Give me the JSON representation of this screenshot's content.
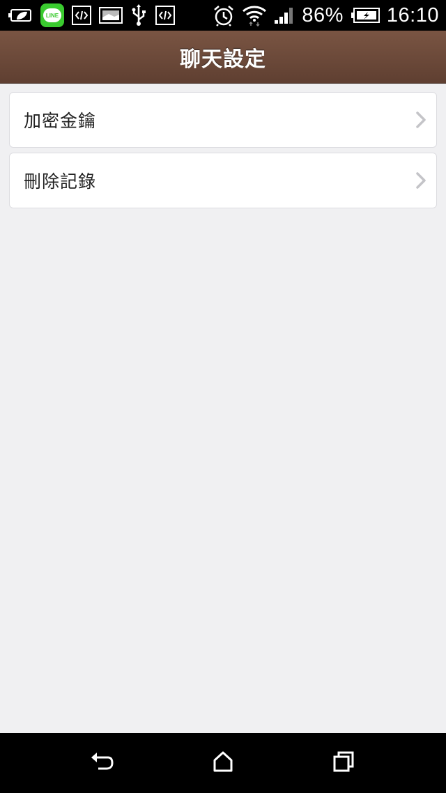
{
  "status_bar": {
    "icons_left": [
      "battery-saver-icon",
      "line-app-icon",
      "code-icon",
      "image-icon",
      "usb-icon",
      "code-icon"
    ],
    "line_badge_text": "LINE",
    "icons_right": [
      "alarm-icon",
      "wifi-icon",
      "signal-icon",
      "battery-icon"
    ],
    "battery_percent": "86%",
    "time": "16:10"
  },
  "header": {
    "title": "聊天設定"
  },
  "menu": {
    "items": [
      {
        "label": "加密金鑰"
      },
      {
        "label": "刪除記錄"
      }
    ]
  },
  "nav_bar": {
    "buttons": [
      "back-icon",
      "home-icon",
      "recents-icon"
    ]
  },
  "colors": {
    "header_top": "#7a5543",
    "header_bottom": "#5f3f31",
    "background": "#f0f0f2",
    "line_green": "#3ACB2F"
  }
}
